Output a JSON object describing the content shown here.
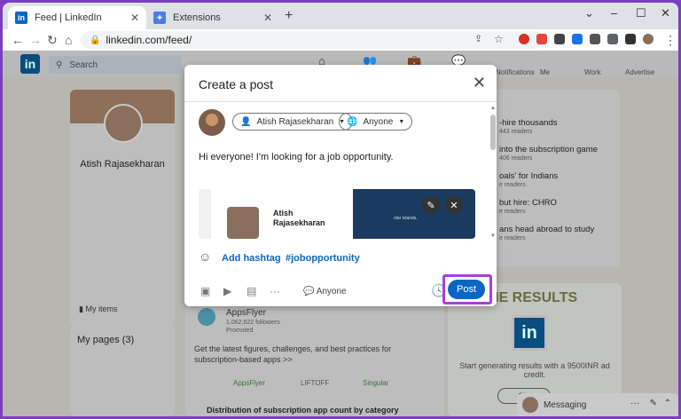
{
  "tabs": [
    {
      "label": "Feed | LinkedIn",
      "icon": "linkedin-icon",
      "active": true
    },
    {
      "label": "Extensions",
      "icon": "puzzle-icon",
      "active": false
    }
  ],
  "address": {
    "url": "linkedin.com/feed/"
  },
  "linkedin_nav": {
    "search_placeholder": "Search",
    "items": [
      "Notifications",
      "Me",
      "Work",
      "Advertise"
    ]
  },
  "left": {
    "name": "Atish Rajasekharan",
    "my_items": "My items",
    "my_pages": "My pages (3)"
  },
  "news": [
    {
      "title": "-hire thousands",
      "meta": "443 readers"
    },
    {
      "title": "into the subscription game",
      "meta": "406 readers"
    },
    {
      "title": "oals' for Indians",
      "meta": "e readers"
    },
    {
      "title": "but hire: CHRO",
      "meta": "e readers"
    },
    {
      "title": "ans head abroad to study",
      "meta": "e readers"
    }
  ],
  "ad": {
    "headline": "TIME RESULTS",
    "logo": "in",
    "text": "Start generating results with a 9500INR ad credit.",
    "button": "Cla"
  },
  "promo": {
    "company": "AppsFlyer",
    "followers": "1,062,622 followers",
    "promoted": "Promoted",
    "body": "Get the latest figures, challenges, and best practices for subscription-based apps >>",
    "partners": [
      "AppsFlyer",
      "LIFTOFF",
      "Singular"
    ],
    "footer": "Distribution of subscription app count by category"
  },
  "messaging": {
    "label": "Messaging"
  },
  "modal": {
    "title": "Create a post",
    "author": "Atish Rajasekharan",
    "audience": "Anyone",
    "text": "Hi everyone! I'm looking for a job opportunity.",
    "preview_name_line1": "Atish",
    "preview_name_line2": "Rajasekharan",
    "preview_right_text": "olar islands,",
    "add_hashtag": "Add hashtag",
    "hashtag": "#jobopportunity",
    "footer_audience": "Anyone",
    "post_label": "Post"
  },
  "colors": {
    "linkedin_blue": "#0a66c2",
    "highlight": "#a93de0"
  }
}
